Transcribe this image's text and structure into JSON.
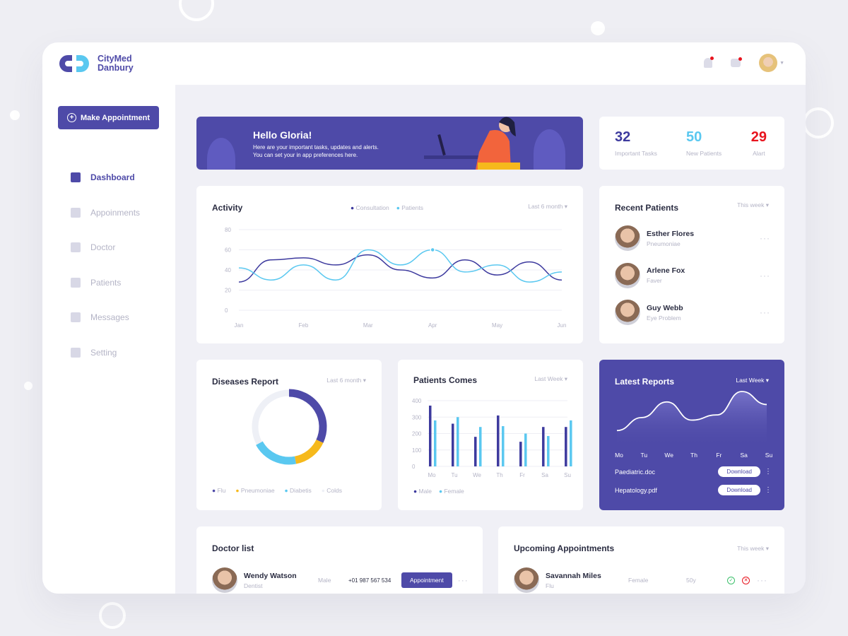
{
  "brand": {
    "line1": "CityMed",
    "line2": "Danbury"
  },
  "make_appointment": "Make Appointment",
  "nav": [
    {
      "label": "Dashboard",
      "icon": "grid-icon",
      "active": true
    },
    {
      "label": "Appoinments",
      "icon": "calendar-icon"
    },
    {
      "label": "Doctor",
      "icon": "medkit-icon"
    },
    {
      "label": "Patients",
      "icon": "user-icon"
    },
    {
      "label": "Messages",
      "icon": "mail-icon"
    },
    {
      "label": "Setting",
      "icon": "gear-icon"
    }
  ],
  "banner": {
    "title": "Hello Gloria!",
    "line1": "Here are your important tasks, updates and alerts.",
    "line2": "You can set your in app preferences here."
  },
  "stats": [
    {
      "value": "32",
      "label": "Important Tasks",
      "color": "#3d3a9e"
    },
    {
      "value": "50",
      "label": "New Patients",
      "color": "#5ac8f0"
    },
    {
      "value": "29",
      "label": "Alart",
      "color": "#e8141e"
    }
  ],
  "activity": {
    "title": "Activity",
    "filter": "Last 6 month"
  },
  "recent": {
    "title": "Recent Patients",
    "filter": "This week",
    "items": [
      {
        "name": "Esther Flores",
        "condition": "Pneumoniae"
      },
      {
        "name": "Arlene Fox",
        "condition": "Faver"
      },
      {
        "name": "Guy Webb",
        "condition": "Eye Problem"
      }
    ]
  },
  "diseases": {
    "title": "Diseases Report",
    "filter": "Last 6 month"
  },
  "patients_comes": {
    "title": "Patients Comes",
    "filter": "Last Week"
  },
  "latest": {
    "title": "Latest Reports",
    "filter": "Last Week",
    "files": [
      {
        "name": "Paediatric.doc",
        "action": "Download"
      },
      {
        "name": "Hepatology.pdf",
        "action": "Download"
      }
    ]
  },
  "doctors": {
    "title": "Doctor list",
    "items": [
      {
        "name": "Wendy Watson",
        "role": "Dentist",
        "gender": "Male",
        "phone": "+01 987 567 534",
        "action": "Appointment"
      }
    ]
  },
  "upcoming": {
    "title": "Upcoming Appointments",
    "filter": "This week",
    "items": [
      {
        "name": "Savannah Miles",
        "condition": "Flu",
        "gender": "Female",
        "age": "50y"
      }
    ]
  },
  "colors": {
    "primary": "#4e4aa8",
    "accent": "#5ac8f0",
    "yellow": "#f6b91c",
    "alert": "#e8141e"
  },
  "chart_data": [
    {
      "type": "line",
      "x": [
        "Jan",
        "",
        "Feb",
        "",
        "Mar",
        "",
        "Apr",
        "",
        "May",
        "",
        "Jun"
      ],
      "xticks": [
        "Jan",
        "Feb",
        "Mar",
        "Apr",
        "May",
        "Jun"
      ],
      "yticks": [
        0,
        20,
        40,
        60,
        80
      ],
      "ylim": [
        0,
        80
      ],
      "grid": true,
      "legend": "top",
      "series": [
        {
          "name": "Consultation",
          "color": "#3d3a9e",
          "values": [
            28,
            50,
            52,
            45,
            55,
            40,
            32,
            50,
            35,
            48,
            30
          ]
        },
        {
          "name": "Patients",
          "color": "#5ac8f0",
          "values": [
            42,
            30,
            45,
            30,
            60,
            45,
            60,
            38,
            45,
            28,
            38
          ]
        }
      ]
    },
    {
      "type": "pie",
      "donut": true,
      "legend": "bottom",
      "categories": [
        "Flu",
        "Pneumoniae",
        "Diabetis",
        "Colds"
      ],
      "values": [
        32,
        15,
        20,
        33
      ],
      "colors": [
        "#4e4aa8",
        "#f6b91c",
        "#5ac8f0",
        "#eef0f6"
      ]
    },
    {
      "type": "bar",
      "categories": [
        "Mo",
        "Tu",
        "We",
        "Th",
        "Fr",
        "Sa",
        "Su"
      ],
      "yticks": [
        0,
        100,
        200,
        300,
        400
      ],
      "ylim": [
        0,
        400
      ],
      "grid": true,
      "legend": "bottom",
      "series": [
        {
          "name": "Male",
          "color": "#3d3a9e",
          "values": [
            370,
            260,
            180,
            310,
            150,
            240,
            240
          ]
        },
        {
          "name": "Female",
          "color": "#5ac8f0",
          "values": [
            280,
            300,
            240,
            245,
            200,
            185,
            280
          ]
        }
      ]
    },
    {
      "type": "area",
      "categories": [
        "Mo",
        "Tu",
        "We",
        "Th",
        "Fr",
        "Sa",
        "Su"
      ],
      "values": [
        20,
        45,
        75,
        40,
        50,
        95,
        70
      ]
    }
  ]
}
